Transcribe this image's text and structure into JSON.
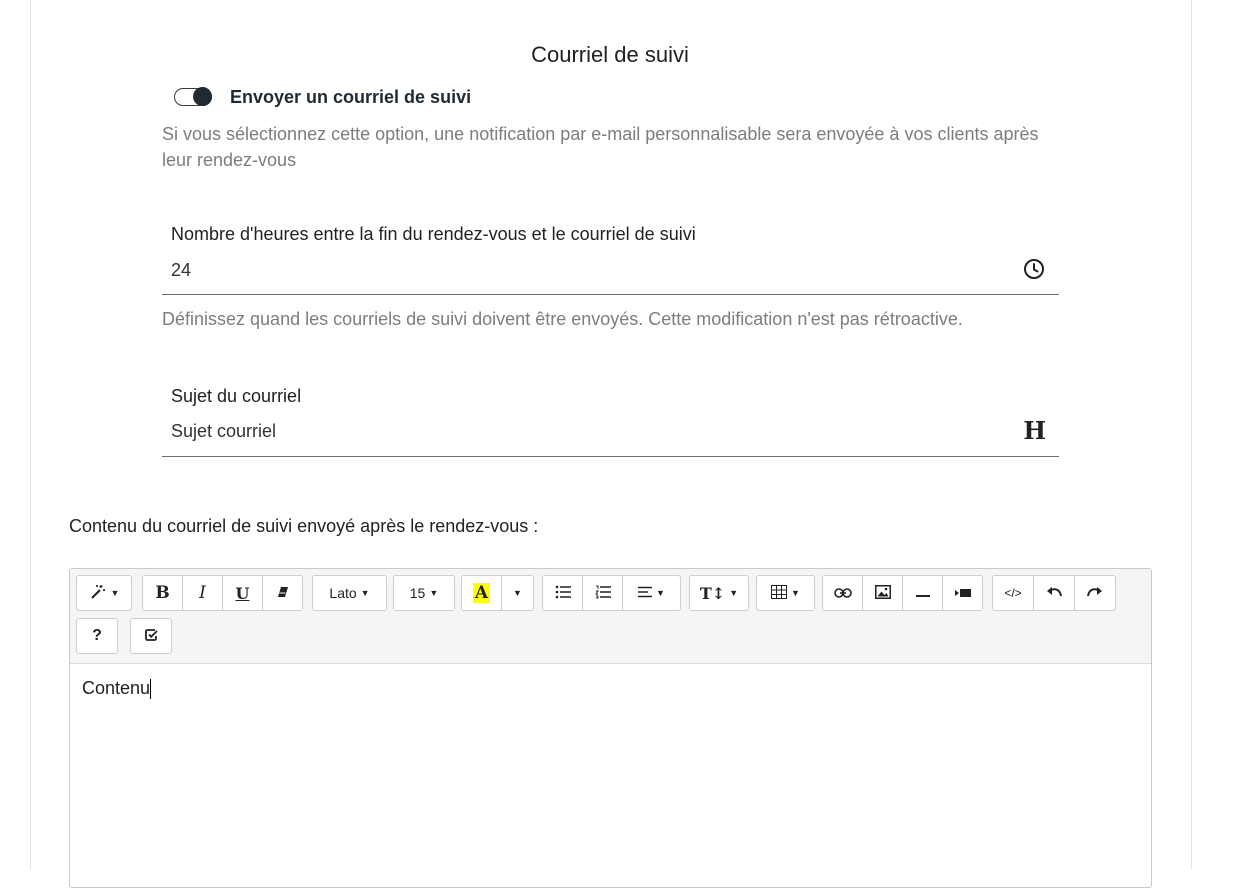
{
  "section": {
    "title": "Courriel de suivi"
  },
  "toggle": {
    "label": "Envoyer un courriel de suivi",
    "on": true
  },
  "toggle_help": "Si vous sélectionnez cette option, une notification par e-mail personnalisable sera envoyée à vos clients après leur rendez-vous",
  "hours_field": {
    "label": "Nombre d'heures entre la fin du rendez-vous et le courriel de suivi",
    "value": "24",
    "icon": "clock-icon",
    "help": "Définissez quand les courriels de suivi doivent être envoyés. Cette modification n'est pas rétroactive."
  },
  "subject_field": {
    "label": "Sujet du courriel",
    "value": "Sujet courriel",
    "icon": "heading-icon",
    "icon_glyph": "H"
  },
  "content_label": "Contenu du courriel de suivi envoyé après le rendez-vous :",
  "toolbar": {
    "font_name": "Lato",
    "font_size": "15",
    "highlight_glyph": "A",
    "highlight_color": "#ffff00",
    "bold": "B",
    "italic": "I",
    "underline": "U",
    "help": "?",
    "codeview": "</>"
  },
  "editor": {
    "content": "Contenu"
  }
}
